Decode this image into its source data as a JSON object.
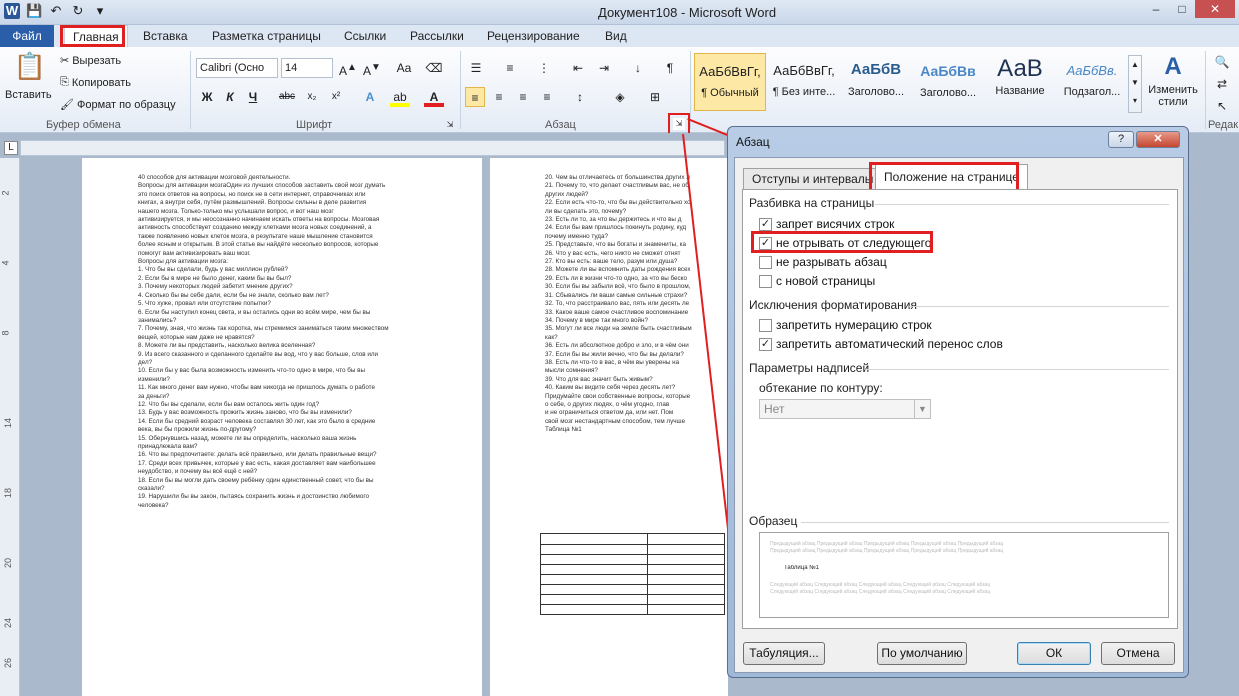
{
  "window": {
    "title": "Документ108 - Microsoft Word"
  },
  "tabs": {
    "file": "Файл",
    "items": [
      "Главная",
      "Вставка",
      "Разметка страницы",
      "Ссылки",
      "Рассылки",
      "Рецензирование",
      "Вид"
    ]
  },
  "ribbon": {
    "clipboard": {
      "paste": "Вставить",
      "cut": "Вырезать",
      "copy": "Копировать",
      "format_painter": "Формат по образцу",
      "label": "Буфер обмена"
    },
    "font": {
      "name": "Calibri (Осно",
      "size": "14",
      "label": "Шрифт"
    },
    "paragraph": {
      "label": "Абзац"
    },
    "styles": {
      "label": "Стили",
      "change": "Изменить стили",
      "items": [
        {
          "sample": "АаБбВвГг,",
          "name": "¶ Обычный"
        },
        {
          "sample": "АаБбВвГг,",
          "name": "¶ Без инте..."
        },
        {
          "sample": "АаБбВ",
          "name": "Заголово..."
        },
        {
          "sample": "АаБбВв",
          "name": "Заголово..."
        },
        {
          "sample": "АаВ",
          "name": "Название"
        },
        {
          "sample": "АаБбВв.",
          "name": "Подзагол..."
        }
      ]
    },
    "editing": {
      "label": "Редак"
    }
  },
  "document": {
    "page1": [
      "40 способов для активации мозговой деятельности.",
      "",
      "Вопросы для активации мозгаОдин из лучших способов заставить свой мозг думать",
      "это поиск ответов на вопросы, но поиск не в сети интернет, справочниках или",
      "книгах, а внутри себя, путём размышлений. Вопросы сильны в деле развития",
      "нашего мозга. Только-только мы услышали вопрос, и вот наш мозг",
      "активизируется, и мы неосознанно начинаем искать ответы на вопросы. Мозговая",
      "активность способствует созданию между клетками мозга новых соединений, а",
      "также появлению новых клеток мозга, в результате наше мышление становится",
      "более ясным и открытым. В этой статье вы найдёте несколько вопросов, которые",
      "помогут вам активизировать ваш мозг.",
      "",
      "Вопросы для активации мозга:",
      "",
      "1. Что бы вы сделали, будь у вас миллион рублей?",
      "2. Если бы в мире не было денег, каким бы вы был?",
      "3. Почему некоторых людей забетит мнение других?",
      "4. Сколько бы вы себе дали, если бы не знали, сколько вам лет?",
      "5. Что хуже, провал или отсутствие попытки?",
      "6. Если бы наступил конец света, и вы остались одни во всём мире, чем бы вы",
      "занимались?",
      "7. Почему, зная, что жизнь так коротка, мы стремимся заниматься таким множеством",
      "вещей, которые нам даже не нравятся?",
      "8. Можете ли вы представить, насколько велика вселенная?",
      "9. Из всего сказанного и сделанного сделайте вы вод, что у вас больше, слов или",
      "дел?",
      "10. Если бы у вас была возможность изменить что-то одно в мире, что бы вы",
      "изменили?",
      "11. Как много денег вам нужно, чтобы вам никогда не пришлось думать о работе",
      "за деньги?",
      "12. Что бы вы сделали, если бы вам осталось жить один год?",
      "13. Будь у вас возможность прожить жизнь заново, что бы вы изменили?",
      "14. Если бы средний возраст человека составлял 30 лет, как это было в средние",
      "века, вы бы прожили жизнь по-другому?",
      "15. Обернувшись назад, можете ли вы определить, насколько ваша жизнь",
      "принадлежала вам?",
      "16. Что вы предпочитаете: делать всё правильно, или делать правильные вещи?",
      "17. Среди всех привычек, которые у вас есть, какая доставляет вам наибольшее",
      "неудобство, и почему вы всё ещё с ней?",
      "18. Если бы вы могли дать своему ребёнку один единственный совет, что бы вы",
      "сказали?",
      "19. Нарушили бы вы закон, пытаясь сохранить жизнь и достоинство любимого",
      "человека?"
    ],
    "page2": [
      "20. Чем вы отличаетесь от большинства других л",
      "21. Почему то, что делает счастливым вас, не об",
      "других людей?",
      "22. Если есть что-то, что бы вы действительно хо",
      "ли вы сделать это, почему?",
      "23. Есть ли то, за что вы держитесь и что вы д",
      "24. Если бы вам пришлось покинуть родину, куд",
      "почему именно туда?",
      "25. Представьте, что вы богаты и знамениты, ка",
      "26. Что у вас есть, чего никто не сможет отнят",
      "27. Кто вы есть: ваше тело, разум или душа?",
      "28. Можете ли вы вспомнить даты рождения всех",
      "29. Есть ли в жизни что-то одно, за что вы беско",
      "30. Если бы вы забыли всё, что было в прошлом,",
      "31. Сбывались ли ваши самые сильные страхи?",
      "32. То, что расстраивало вас, пять или десять ле",
      "33. Какое ваше самое счастливое воспоминание",
      "34. Почему в мире так много войн?",
      "35. Могут ли все люди на земле быть счастливым",
      "как?",
      "36. Есть ли абсолютное добро и зло, и в чём они",
      "37. Если бы вы жили вечно, что бы вы делали?",
      "38. Есть ли что-то в вас, в чём вы уверены на",
      "мысли сомнения?",
      "39. Что для вас значит быть живым?",
      "40. Каким вы видите себя через десять лет?",
      "Придумайте свои собственные вопросы, которые",
      "о себе, о других людях, о чём угодно, глав",
      "и не ограничиться ответом да, или нет. Пом",
      "свой мозг нестандартным способом, тем лучше",
      "",
      "Таблица №1"
    ]
  },
  "dialog": {
    "title": "Абзац",
    "help": "?",
    "close": "✕",
    "tabs": [
      "Отступы и интервалы",
      "Положение на странице"
    ],
    "pagination": {
      "label": "Разбивка на страницы",
      "items": [
        {
          "label": "запрет висячих строк",
          "checked": "✓"
        },
        {
          "label": "не отрывать от следующего",
          "checked": "✓"
        },
        {
          "label": "не разрывать абзац",
          "checked": ""
        },
        {
          "label": "с новой страницы",
          "checked": ""
        }
      ]
    },
    "exceptions": {
      "label": "Исключения форматирования",
      "items": [
        {
          "label": "запретить нумерацию строк",
          "checked": ""
        },
        {
          "label": "запретить автоматический перенос слов",
          "checked": "✓"
        }
      ]
    },
    "textbox": {
      "label": "Параметры надписей",
      "wrap_label": "обтекание по контуру:",
      "wrap_value": "Нет"
    },
    "preview": {
      "label": "Образец",
      "prev_text": "Предыдущий абзац Предыдущий абзац Предыдущий абзац Предыдущий абзац Предыдущий абзац",
      "sample": "Таблица №1",
      "next_text": "Следующий абзац Следующий абзац Следующий абзац Следующий абзац Следующий абзац"
    },
    "buttons": {
      "tabs": "Табуляция...",
      "default": "По умолчанию",
      "ok": "ОК",
      "cancel": "Отмена"
    }
  },
  "colors": {
    "file_tab": "#2a5ea8",
    "highlight": "#e02020"
  }
}
